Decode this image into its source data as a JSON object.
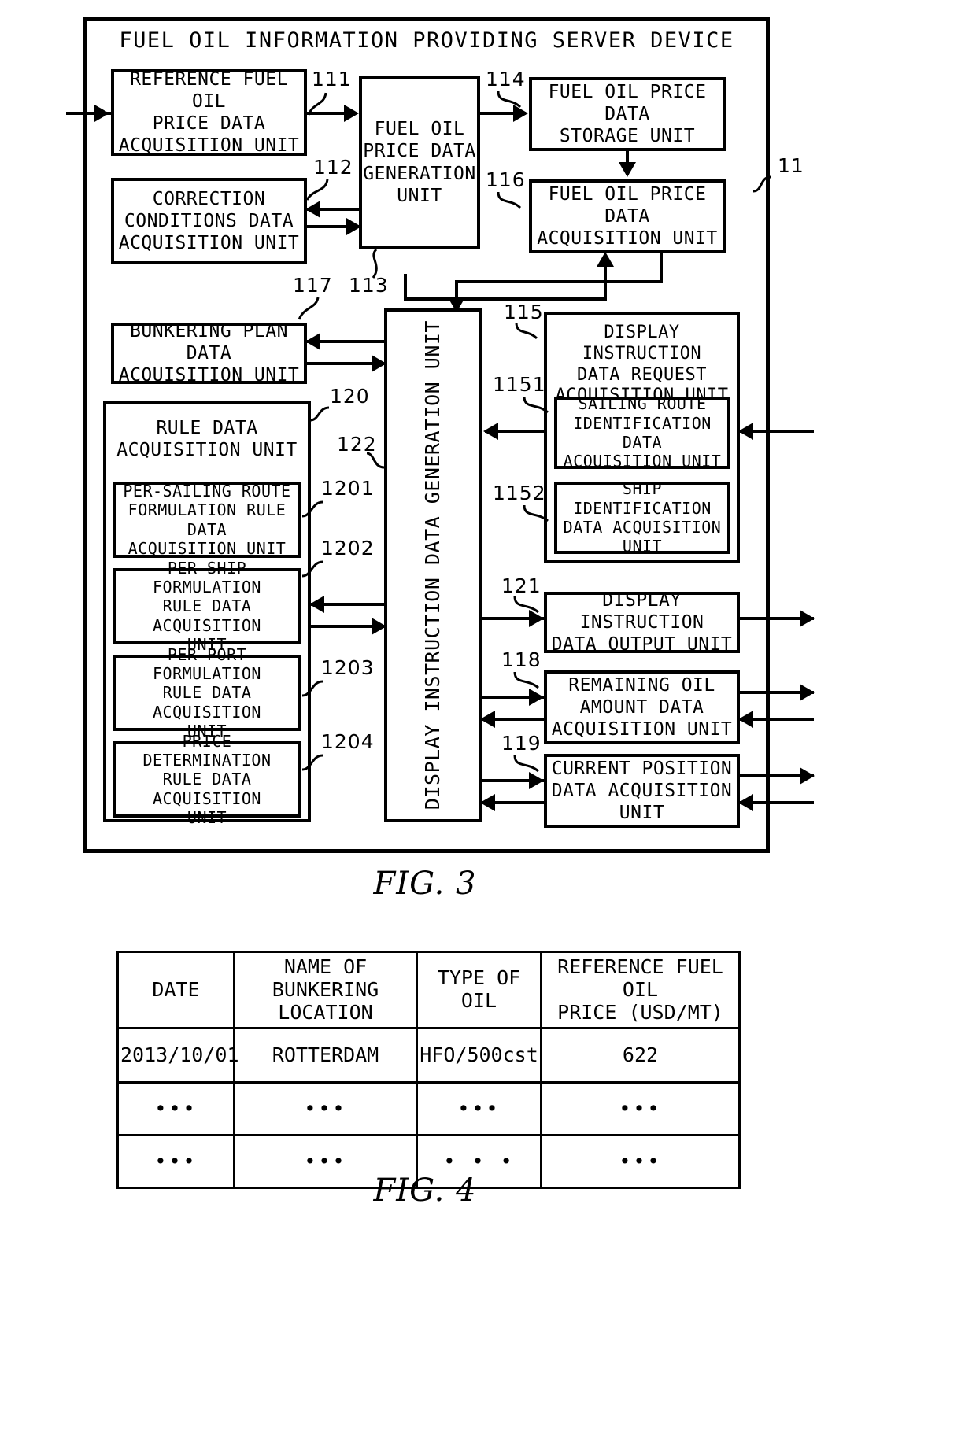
{
  "figure3": {
    "title": "FUEL OIL INFORMATION PROVIDING SERVER DEVICE",
    "caption": "FIG. 3",
    "outer_ref": "11",
    "blocks": {
      "b111": {
        "label": "REFERENCE FUEL OIL\nPRICE DATA\nACQUISITION UNIT",
        "ref": "111"
      },
      "b112": {
        "label": "CORRECTION\nCONDITIONS DATA\nACQUISITION UNIT",
        "ref": "112"
      },
      "b113": {
        "label": "FUEL OIL\nPRICE DATA\nGENERATION\nUNIT",
        "ref": "113"
      },
      "b114": {
        "label": "FUEL OIL PRICE DATA\nSTORAGE UNIT",
        "ref": "114"
      },
      "b116": {
        "label": "FUEL OIL PRICE DATA\nACQUISITION UNIT",
        "ref": "116"
      },
      "b117": {
        "label": "BUNKERING PLAN DATA\nACQUISITION UNIT",
        "ref": "117"
      },
      "b120": {
        "label": "RULE DATA\nACQUISITION UNIT",
        "ref": "120"
      },
      "b1201": {
        "label": "PER-SAILING ROUTE\nFORMULATION RULE DATA\nACQUISITION UNIT",
        "ref": "1201"
      },
      "b1202": {
        "label": "PER-SHIP FORMULATION\nRULE DATA ACQUISITION\nUNIT",
        "ref": "1202"
      },
      "b1203": {
        "label": "PER-PORT FORMULATION\nRULE DATA ACQUISITION\nUNIT",
        "ref": "1203"
      },
      "b1204": {
        "label": "PRICE DETERMINATION\nRULE DATA ACQUISITION\nUNIT",
        "ref": "1204"
      },
      "b122": {
        "label": "DISPLAY INSTRUCTION DATA GENERATION UNIT",
        "ref": "122"
      },
      "b115": {
        "label": "DISPLAY INSTRUCTION\nDATA REQUEST\nACQUISITION UNIT",
        "ref": "115"
      },
      "b1151": {
        "label": "SAILING ROUTE\nIDENTIFICATION DATA\nACQUISITION UNIT",
        "ref": "1151"
      },
      "b1152": {
        "label": "SHIP IDENTIFICATION\nDATA ACQUISITION\nUNIT",
        "ref": "1152"
      },
      "b121": {
        "label": "DISPLAY INSTRUCTION\nDATA OUTPUT UNIT",
        "ref": "121"
      },
      "b118": {
        "label": "REMAINING OIL\nAMOUNT DATA\nACQUISITION UNIT",
        "ref": "118"
      },
      "b119": {
        "label": "CURRENT POSITION\nDATA ACQUISITION\nUNIT",
        "ref": "119"
      }
    }
  },
  "figure4": {
    "caption": "FIG. 4",
    "headers": [
      "DATE",
      "NAME OF BUNKERING\nLOCATION",
      "TYPE OF OIL",
      "REFERENCE FUEL OIL\nPRICE  (USD/MT)"
    ],
    "rows": [
      [
        "2013/10/01",
        "ROTTERDAM",
        "HFO/500cst",
        "622"
      ],
      [
        "•••",
        "•••",
        "•••",
        "•••"
      ],
      [
        "•••",
        "•••",
        "• • •",
        "•••"
      ]
    ]
  }
}
